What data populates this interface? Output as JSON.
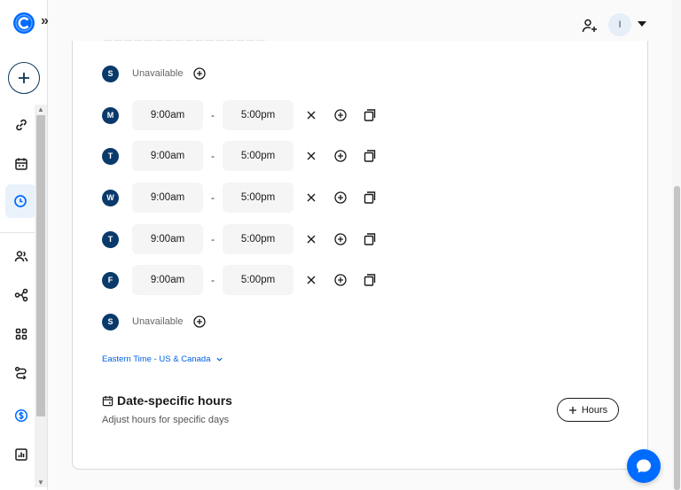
{
  "header": {
    "avatar_initial": "I"
  },
  "schedule": {
    "unavailable_label": "Unavailable",
    "days": [
      {
        "letter": "S",
        "available": false
      },
      {
        "letter": "M",
        "available": true,
        "start": "9:00am",
        "end": "5:00pm"
      },
      {
        "letter": "T",
        "available": true,
        "start": "9:00am",
        "end": "5:00pm"
      },
      {
        "letter": "W",
        "available": true,
        "start": "9:00am",
        "end": "5:00pm"
      },
      {
        "letter": "T",
        "available": true,
        "start": "9:00am",
        "end": "5:00pm"
      },
      {
        "letter": "F",
        "available": true,
        "start": "9:00am",
        "end": "5:00pm"
      },
      {
        "letter": "S",
        "available": false
      }
    ],
    "range_separator": "-",
    "timezone": "Eastern Time - US & Canada"
  },
  "date_specific": {
    "title": "Date-specific hours",
    "subtitle": "Adjust hours for specific days",
    "add_button": "Hours"
  },
  "colors": {
    "primary": "#006bff",
    "navy": "#0a3a6b",
    "link": "#0060e6"
  }
}
